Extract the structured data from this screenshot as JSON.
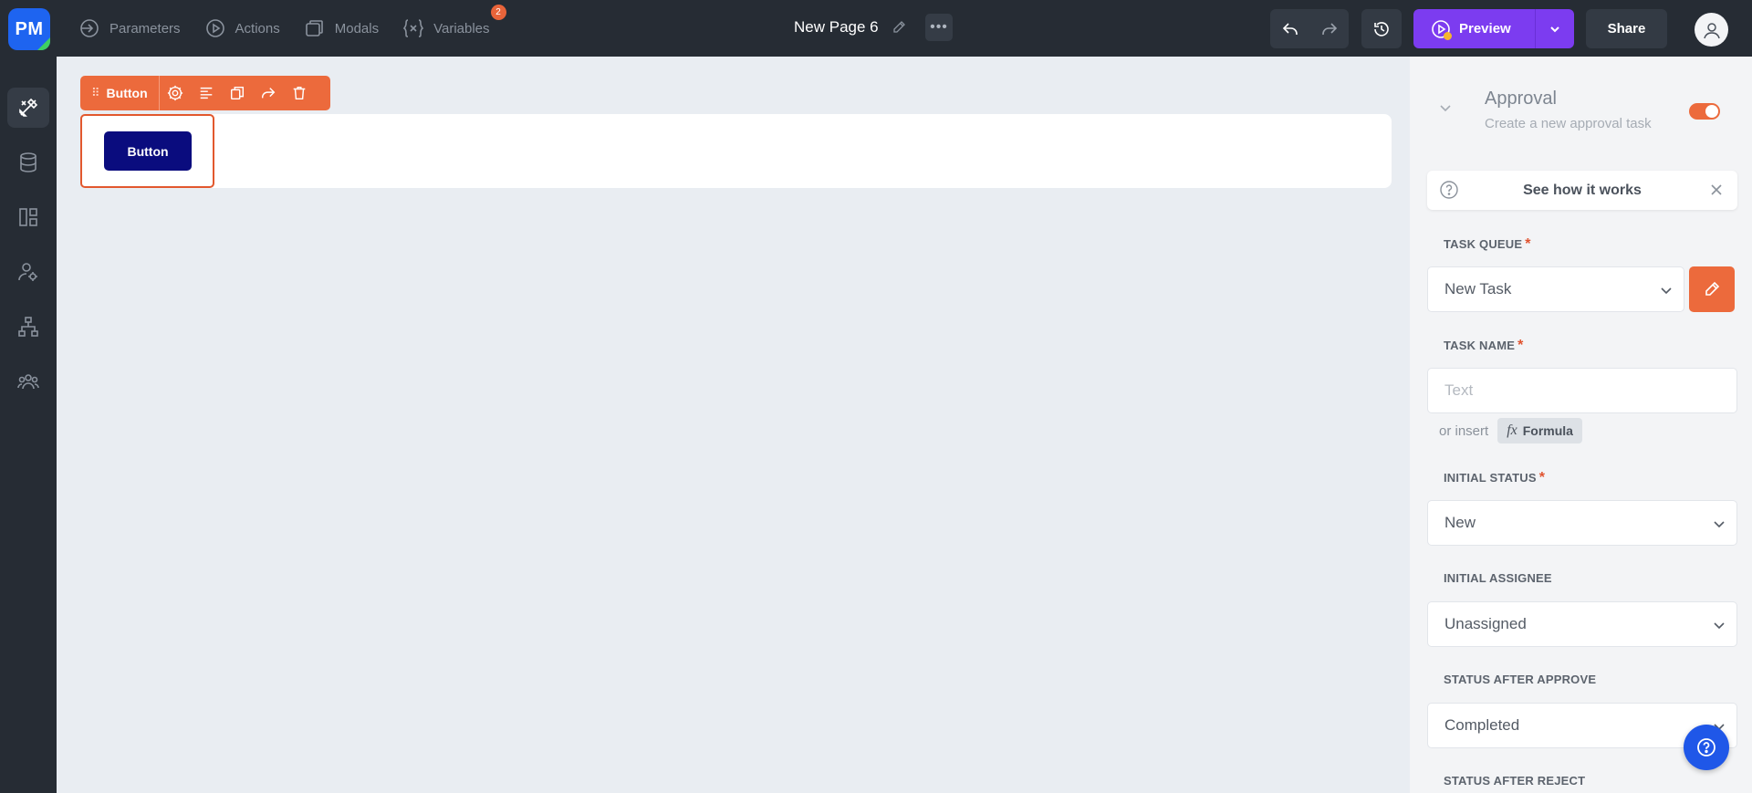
{
  "app": {
    "logo_text": "PM"
  },
  "topnav": {
    "tabs": [
      {
        "label": "Parameters",
        "icon": "parameters-icon"
      },
      {
        "label": "Actions",
        "icon": "play-circle-icon"
      },
      {
        "label": "Modals",
        "icon": "modals-icon"
      },
      {
        "label": "Variables",
        "icon": "variable-icon",
        "badge": "2"
      }
    ],
    "page_title": "New Page 6",
    "more_label": "•••",
    "preview_label": "Preview",
    "share_label": "Share"
  },
  "sidebar": {
    "items": [
      {
        "icon": "design-tools-icon",
        "active": true
      },
      {
        "icon": "database-icon",
        "active": false
      },
      {
        "icon": "layout-icon",
        "active": false
      },
      {
        "icon": "user-settings-icon",
        "active": false
      },
      {
        "icon": "hierarchy-icon",
        "active": false
      },
      {
        "icon": "team-icon",
        "active": false
      }
    ]
  },
  "canvas": {
    "toolbar_label": "Button",
    "grip": "⠿",
    "button_label": "Button"
  },
  "panel": {
    "title": "Approval",
    "subtitle": "Create a new approval task",
    "enabled": true,
    "howit_label": "See how it works",
    "fields": {
      "task_queue": {
        "label": "TASK QUEUE",
        "value": "New Task",
        "required": true
      },
      "task_name": {
        "label": "TASK NAME",
        "placeholder": "Text",
        "required": true
      },
      "or_insert": "or insert",
      "formula_label": "Formula",
      "formula_glyph": "fx",
      "initial_status": {
        "label": "INITIAL STATUS",
        "value": "New",
        "required": true
      },
      "initial_assignee": {
        "label": "INITIAL ASSIGNEE",
        "value": "Unassigned"
      },
      "status_after_approve": {
        "label": "STATUS AFTER APPROVE",
        "value": "Completed"
      },
      "status_after_reject": {
        "label": "STATUS AFTER REJECT"
      }
    },
    "required_mark": "*"
  },
  "colors": {
    "accent": "#ec6a3c",
    "preview": "#7c3cf0",
    "canvas_button": "#0a0c7e",
    "help_fab": "#1f57e8"
  }
}
